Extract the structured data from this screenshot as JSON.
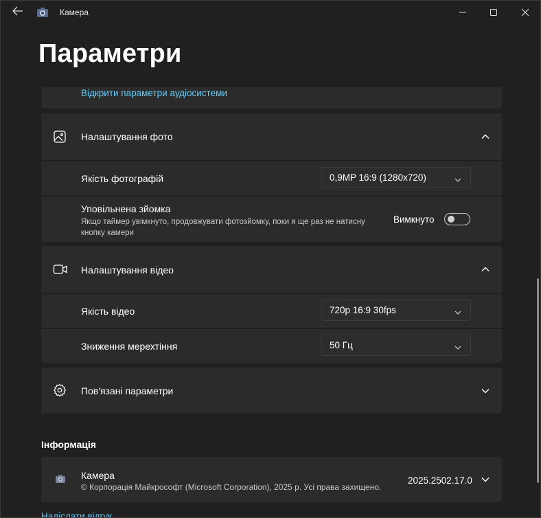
{
  "titlebar": {
    "app_title": "Камера",
    "back_icon": "back-arrow-icon",
    "minimize_icon": "minimize-icon",
    "maximize_icon": "maximize-icon",
    "close_icon": "close-icon"
  },
  "page": {
    "title": "Параметри"
  },
  "audio": {
    "link": "Відкрити параметри аудіосистеми"
  },
  "photo": {
    "section_title": "Налаштування фото",
    "icon": "image-icon",
    "quality_label": "Якість фотографій",
    "quality_value": "0,9MP 16:9 (1280x720)",
    "slowmo_title": "Уповільнена зйомка",
    "slowmo_desc": "Якщо таймер увімкнуто, продовжувати фотозйомку, поки я ще раз не натисну кнопку камери",
    "slowmo_state": "Вимкнуто",
    "slowmo_on": false
  },
  "video": {
    "section_title": "Налаштування відео",
    "icon": "video-camera-icon",
    "quality_label": "Якість відео",
    "quality_value": "720p 16:9 30fps",
    "flicker_label": "Зниження мерехтіння",
    "flicker_value": "50 Гц"
  },
  "related": {
    "section_title": "Пов'язані параметри",
    "icon": "gear-icon"
  },
  "info": {
    "heading": "Інформація",
    "app_name": "Камера",
    "copyright": "© Корпорація Майкрософт (Microsoft Corporation), 2025 р. Усі права захищено.",
    "version": "2025.2502.17.0",
    "feedback_link": "Надіслати відгук"
  },
  "colors": {
    "accent_link": "#60cdff",
    "background": "#202020",
    "card": "#2b2b2b"
  }
}
